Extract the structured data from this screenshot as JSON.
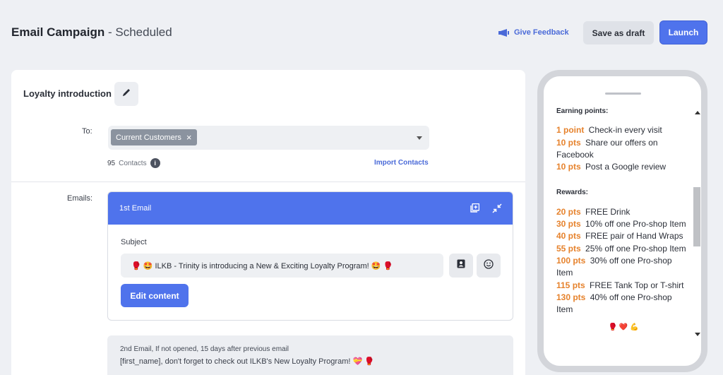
{
  "header": {
    "title_bold": "Email Campaign",
    "title_sep": " - ",
    "title_status": "Scheduled",
    "feedback_label": "Give Feedback",
    "save_draft_label": "Save as draft",
    "launch_label": "Launch"
  },
  "campaign": {
    "name": "Loyalty introduction",
    "to_label": "To:",
    "recipient_chip": "Current Customers",
    "contacts_count": "95",
    "contacts_label": "Contacts",
    "import_label": "Import Contacts",
    "emails_label": "Emails:"
  },
  "first_email": {
    "header": "1st Email",
    "subject_label": "Subject",
    "subject_value": "🥊 🤩 ILKB - Trinity is introducing a New & Exciting Loyalty Program! 🤩 🥊",
    "edit_button": "Edit content"
  },
  "second_email": {
    "line1": "2nd Email, If not opened, 15 days after previous email",
    "line2": "[first_name], don't forget to check out ILKB's New Loyalty Program! 💝 🥊"
  },
  "preview": {
    "earning_title": "Earning points:",
    "earning": [
      {
        "pts": "1 point",
        "text": "Check-in every visit"
      },
      {
        "pts": "10 pts",
        "text": "Share our offers on Facebook"
      },
      {
        "pts": "10 pts",
        "text": "Post a Google review"
      }
    ],
    "rewards_title": "Rewards:",
    "rewards": [
      {
        "pts": "20 pts",
        "text": "FREE Drink"
      },
      {
        "pts": "30 pts",
        "text": "10% off one Pro-shop Item"
      },
      {
        "pts": "40 pts",
        "text": "FREE pair of Hand Wraps"
      },
      {
        "pts": "55 pts",
        "text": "25% off one Pro-shop Item"
      },
      {
        "pts": "100 pts",
        "text": "30% off one Pro-shop Item"
      },
      {
        "pts": "115 pts",
        "text": "FREE Tank Top or T-shirt"
      },
      {
        "pts": "130 pts",
        "text": "40% off one Pro-shop Item"
      }
    ],
    "footer_emojis": "🥊 ❤️ 💪"
  },
  "colors": {
    "accent": "#4f73ec",
    "points_orange": "#e6822c"
  },
  "icons": [
    "megaphone-icon",
    "pencil-icon",
    "info-icon",
    "duplicate-icon",
    "collapse-icon",
    "contact-card-icon",
    "smiley-icon"
  ]
}
